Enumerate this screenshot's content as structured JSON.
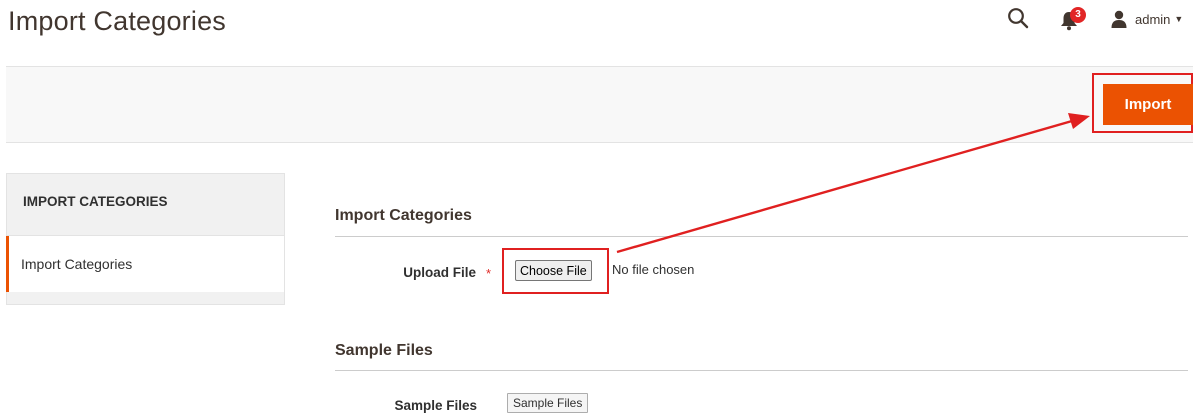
{
  "header": {
    "title": "Import Categories",
    "notifications_count": "3",
    "user_name": "admin"
  },
  "toolbar": {
    "import_label": "Import"
  },
  "sidebar": {
    "section_title": "IMPORT CATEGORIES",
    "items": [
      {
        "label": "Import Categories"
      }
    ]
  },
  "main": {
    "import_section": {
      "title": "Import Categories",
      "upload_label": "Upload File",
      "required_mark": "*",
      "choose_file_label": "Choose File",
      "file_status": "No file chosen"
    },
    "sample_section": {
      "title": "Sample Files",
      "label": "Sample Files",
      "button_label": "Sample Files"
    }
  },
  "colors": {
    "accent": "#eb5202",
    "annotation": "#e02020",
    "badge": "#e22626"
  },
  "icons": {
    "search": "search-icon",
    "notifications": "bell-icon",
    "user": "user-icon",
    "caret": "caret-down-icon"
  }
}
